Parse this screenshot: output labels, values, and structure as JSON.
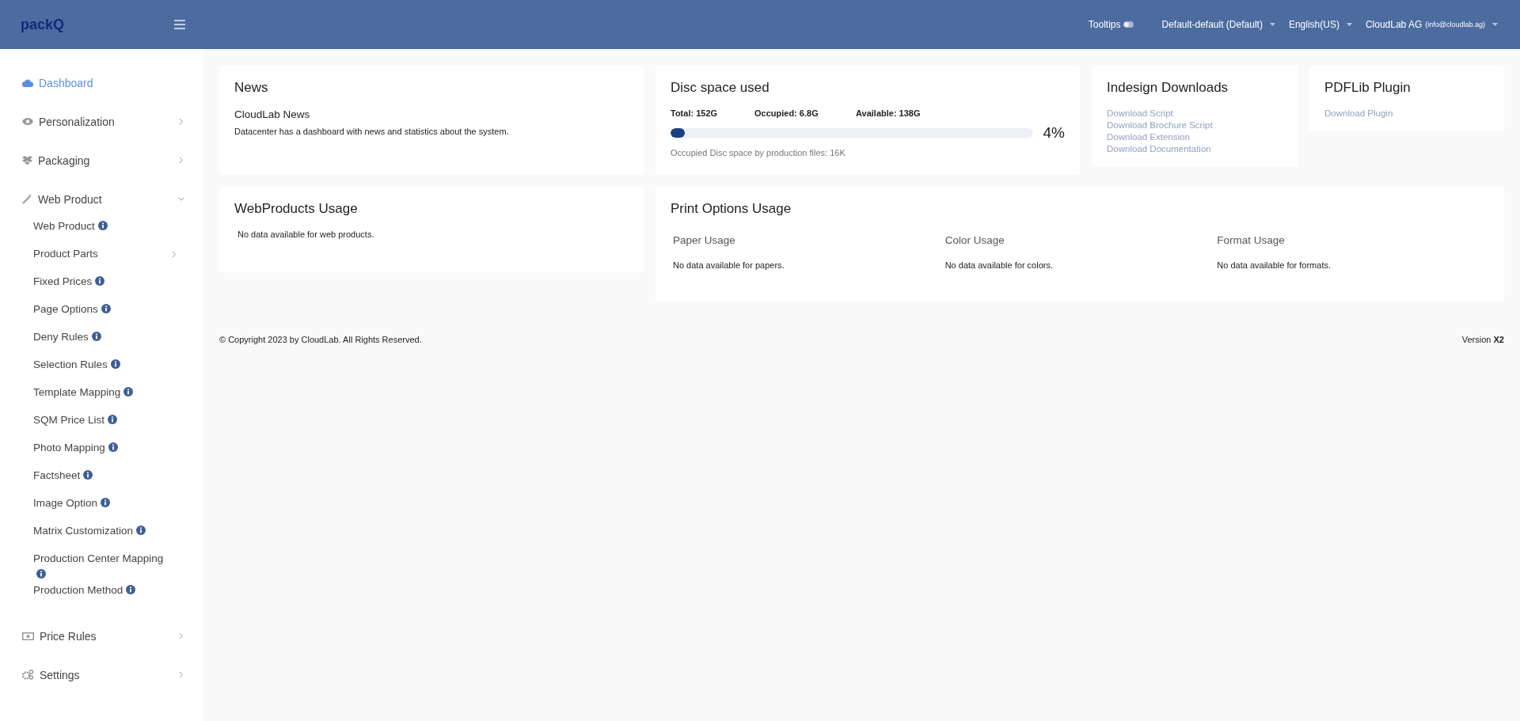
{
  "header": {
    "logo": "packQ",
    "tooltips": {
      "label": "Tooltips",
      "on": false
    },
    "menus": [
      {
        "label": "Default-default (Default)"
      },
      {
        "label": "English(US)"
      },
      {
        "label": "CloudLab AG",
        "detail": "(info@cloudlab.ag)"
      }
    ]
  },
  "sidebar": {
    "items": [
      {
        "label": "Dashboard",
        "selected": true,
        "expanded": false,
        "has_children": false
      },
      {
        "label": "Personalization",
        "selected": false,
        "expanded": false,
        "has_children": true
      },
      {
        "label": "Packaging",
        "selected": false,
        "expanded": false,
        "has_children": true
      },
      {
        "label": "Web Product",
        "selected": false,
        "expanded": true,
        "has_children": true,
        "children": [
          {
            "label": "Web Product",
            "info": true,
            "has_children": false
          },
          {
            "label": "Product Parts",
            "info": false,
            "has_children": true
          },
          {
            "label": "Fixed Prices",
            "info": true,
            "has_children": false
          },
          {
            "label": "Page Options",
            "info": true,
            "has_children": false
          },
          {
            "label": "Deny Rules",
            "info": true,
            "has_children": false
          },
          {
            "label": "Selection Rules",
            "info": true,
            "has_children": false
          },
          {
            "label": "Template Mapping",
            "info": true,
            "has_children": false
          },
          {
            "label": "SQM Price List",
            "info": true,
            "has_children": false
          },
          {
            "label": "Photo Mapping",
            "info": true,
            "has_children": false
          },
          {
            "label": "Factsheet",
            "info": true,
            "has_children": false
          },
          {
            "label": "Image Option",
            "info": true,
            "has_children": false
          },
          {
            "label": "Matrix Customization",
            "info": true,
            "has_children": false
          },
          {
            "label": "Production Center Mapping",
            "info": true,
            "has_children": false
          },
          {
            "label": "Production Method",
            "info": true,
            "has_children": false
          }
        ]
      },
      {
        "label": "Price Rules",
        "selected": false,
        "expanded": false,
        "has_children": true
      },
      {
        "label": "Settings",
        "selected": false,
        "expanded": false,
        "has_children": true
      }
    ]
  },
  "news": {
    "title": "News",
    "heading": "CloudLab News",
    "text": "Datacenter has a dashboard with news and statistics about the system."
  },
  "disc": {
    "title": "Disc space used",
    "stats": [
      "Total: 152G",
      "Occupied: 6.8G",
      "Available: 138G"
    ],
    "level": 0.04,
    "reading": "4%",
    "note": "Occupied Disc space by production files: 16K"
  },
  "indesign": {
    "title": "Indesign Downloads",
    "links": [
      "Download Script",
      "Download Brochure Script",
      "Download Extension",
      "Download Documentation"
    ]
  },
  "pdflib": {
    "title": "PDFLib Plugin",
    "links": [
      "Download Plugin"
    ]
  },
  "webproducts": {
    "title": "WebProducts Usage",
    "text": "No data available for web products."
  },
  "print_options": {
    "title": "Print Options Usage",
    "columns": [
      {
        "title": "Paper Usage",
        "text": "No data available for papers."
      },
      {
        "title": "Color Usage",
        "text": "No data available for colors."
      },
      {
        "title": "Format Usage",
        "text": "No data available for formats."
      }
    ]
  },
  "footer": {
    "copyright": "© Copyright 2023 by CloudLab. All Rights Reserved.",
    "version_label": "Version",
    "version": "X2"
  }
}
